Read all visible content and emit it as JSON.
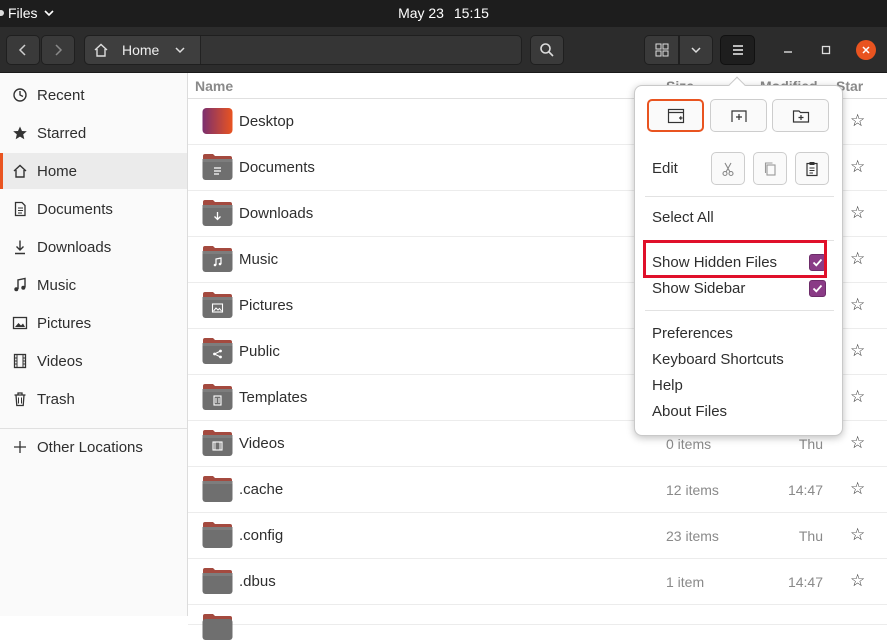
{
  "topbar": {
    "app_name": "Files",
    "date": "May 23",
    "time": "15:15"
  },
  "header": {
    "path_label": "Home"
  },
  "sidebar": {
    "items": [
      {
        "label": "Recent"
      },
      {
        "label": "Starred"
      },
      {
        "label": "Home"
      },
      {
        "label": "Documents"
      },
      {
        "label": "Downloads"
      },
      {
        "label": "Music"
      },
      {
        "label": "Pictures"
      },
      {
        "label": "Videos"
      },
      {
        "label": "Trash"
      },
      {
        "label": "Other Locations"
      }
    ]
  },
  "columns": {
    "name": "Name",
    "size": "Size",
    "modified": "Modified",
    "star": "Star"
  },
  "files": [
    {
      "name": "Desktop",
      "size": "",
      "modified": ""
    },
    {
      "name": "Documents",
      "size": "",
      "modified": ""
    },
    {
      "name": "Downloads",
      "size": "",
      "modified": ""
    },
    {
      "name": "Music",
      "size": "",
      "modified": ""
    },
    {
      "name": "Pictures",
      "size": "",
      "modified": ""
    },
    {
      "name": "Public",
      "size": "",
      "modified": ""
    },
    {
      "name": "Templates",
      "size": "",
      "modified": ""
    },
    {
      "name": "Videos",
      "size": "0 items",
      "modified": "Thu"
    },
    {
      "name": ".cache",
      "size": "12 items",
      "modified": "14:47"
    },
    {
      "name": ".config",
      "size": "23 items",
      "modified": "Thu"
    },
    {
      "name": ".dbus",
      "size": "1 item",
      "modified": "14:47"
    }
  ],
  "menu": {
    "edit_label": "Edit",
    "select_all": "Select All",
    "show_hidden": "Show Hidden Files",
    "show_sidebar": "Show Sidebar",
    "preferences": "Preferences",
    "shortcuts": "Keyboard Shortcuts",
    "help": "Help",
    "about": "About Files"
  },
  "colors": {
    "accent": "#e95420",
    "checkbox": "#8a3b86",
    "highlight": "#e0102a"
  }
}
